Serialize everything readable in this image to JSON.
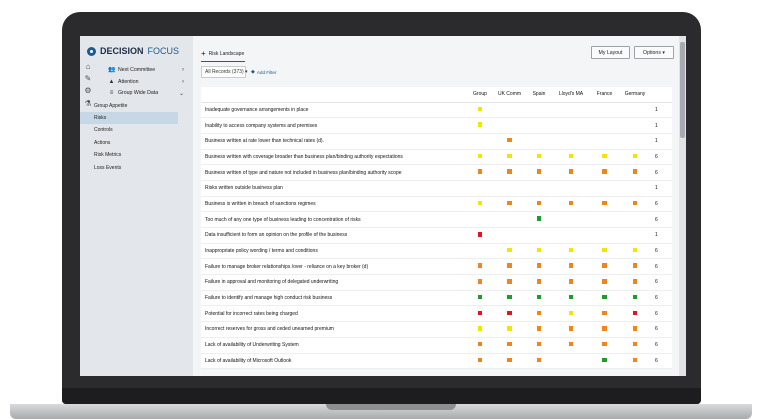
{
  "app": {
    "logo_bold": "DECISION",
    "logo_light": "FOCUS"
  },
  "sidebar": {
    "items": [
      {
        "label": "Next Committee",
        "icon": "people-icon",
        "chevron": "›"
      },
      {
        "label": "Attention",
        "icon": "warning-icon",
        "chevron": "›"
      },
      {
        "label": "Group Wide Data",
        "icon": "database-icon",
        "chevron": "⌄"
      }
    ],
    "sub_items": [
      {
        "label": "Group Appetite",
        "active": false
      },
      {
        "label": "Risks",
        "active": true
      },
      {
        "label": "Controls",
        "active": false
      },
      {
        "label": "Actions",
        "active": false
      },
      {
        "label": "Risk Metrics",
        "active": false
      },
      {
        "label": "Loss Events",
        "active": false
      }
    ]
  },
  "toolbar": {
    "tab_label": "Risk Landscape",
    "my_layout": "My Layout",
    "options": "Options ▾",
    "records": "All Records (373) ▾",
    "add_filter": "Add Filter"
  },
  "table": {
    "columns": [
      "Group",
      "UK Comm",
      "Spain",
      "Lloyd's MA",
      "France",
      "Germany",
      ""
    ],
    "colors": {
      "Y": "#f2e500",
      "O": "#f08519",
      "G": "#1e9a2e",
      "R": "#e3141b"
    },
    "rows": [
      {
        "risk": "Inadequate governance arrangements in place",
        "cells": [
          "Y",
          "",
          "",
          "",
          "",
          ""
        ],
        "count": "1"
      },
      {
        "risk": "Inability to access company systems and premises",
        "cells": [
          "Y",
          "",
          "",
          "",
          "",
          ""
        ],
        "count": "1"
      },
      {
        "risk": "Business written at rate lower than technical rates (d).",
        "cells": [
          "",
          "O",
          "",
          "",
          "",
          ""
        ],
        "count": "1"
      },
      {
        "risk": "Business written with coverage broader than business plan/binding authority expectations",
        "cells": [
          "Y",
          "Y",
          "Y",
          "Y",
          "Y",
          "Y"
        ],
        "count": "6"
      },
      {
        "risk": "Business written of type and nature not included in business plan/binding authority scope",
        "cells": [
          "O",
          "O",
          "O",
          "O",
          "O",
          "O"
        ],
        "count": "6"
      },
      {
        "risk": "Risks written outside business plan",
        "cells": [
          "",
          "",
          "",
          "",
          "",
          ""
        ],
        "count": "1"
      },
      {
        "risk": "Business is written in breach of sanctions regimes",
        "cells": [
          "Y",
          "O",
          "O",
          "O",
          "O",
          "O"
        ],
        "count": "6"
      },
      {
        "risk": "Too much of any one type of business leading to concentration of risks",
        "cells": [
          "",
          "",
          "G",
          "",
          "",
          ""
        ],
        "count": "6"
      },
      {
        "risk": "Data insufficient to form an opinion on the profile of the business",
        "cells": [
          "R",
          "",
          "",
          "",
          "",
          ""
        ],
        "count": "1"
      },
      {
        "risk": "Inappropriate policy wording / terms and conditions",
        "cells": [
          "",
          "Y",
          "Y",
          "Y",
          "Y",
          "Y"
        ],
        "count": "6"
      },
      {
        "risk": "Failure to manage broker relationships /over - reliance on a key broker (d)",
        "cells": [
          "O",
          "O",
          "O",
          "O",
          "O",
          "O"
        ],
        "count": "6"
      },
      {
        "risk": "Failure in approval and monitoring of delegated underwriting",
        "cells": [
          "O",
          "O",
          "O",
          "O",
          "O",
          "O"
        ],
        "count": "6"
      },
      {
        "risk": "Failure to identify and manage high conduct risk business",
        "cells": [
          "G",
          "G",
          "G",
          "G",
          "G",
          "G"
        ],
        "count": "6"
      },
      {
        "risk": "Potential for incorrect rates being charged",
        "cells": [
          "R",
          "R",
          "O",
          "Y",
          "O",
          "R"
        ],
        "count": "6"
      },
      {
        "risk": "Incorrect reserves for gross and ceded unearned premium",
        "cells": [
          "Y",
          "Y",
          "O",
          "O",
          "O",
          "O"
        ],
        "count": "6"
      },
      {
        "risk": "Lack of availability of Underwriting System",
        "cells": [
          "O",
          "O",
          "O",
          "O",
          "O",
          "O"
        ],
        "count": "6"
      },
      {
        "risk": "Lack of availability of Microsoft Outlook",
        "cells": [
          "O",
          "O",
          "O",
          "",
          "G",
          "O"
        ],
        "count": "6"
      }
    ]
  }
}
